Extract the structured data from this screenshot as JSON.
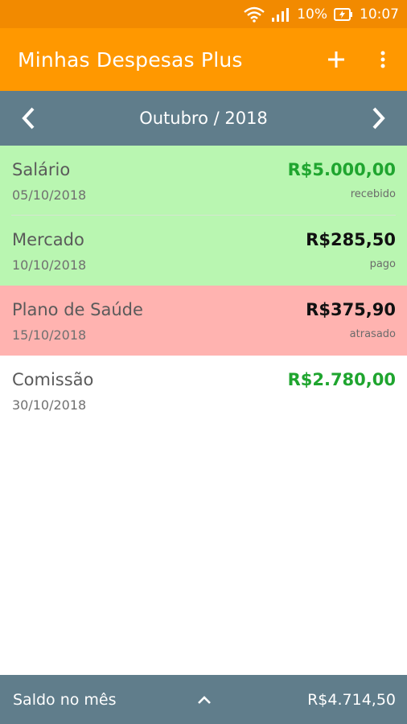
{
  "status_bar": {
    "battery_percent": "10%",
    "time": "10:07",
    "icons": [
      "wifi-icon",
      "signal-icon",
      "battery-charging-icon"
    ]
  },
  "app_bar": {
    "title": "Minhas Despesas Plus",
    "add_icon": "plus-icon",
    "more_icon": "more-vert-icon"
  },
  "month_bar": {
    "label": "Outubro / 2018",
    "prev_icon": "chevron-left-icon",
    "next_icon": "chevron-right-icon"
  },
  "colors": {
    "status_bar": "#f28a00",
    "app_bar": "#ff9800",
    "month_bar": "#607d8b",
    "received_bg": "#b9f6b1",
    "late_bg": "#ffb3b0",
    "income_text": "#1fa52f",
    "expense_text": "#111111"
  },
  "transactions": [
    {
      "title": "Salário",
      "date": "05/10/2018",
      "amount": "R$5.000,00",
      "status": "recebido",
      "kind": "income",
      "bg": "#b9f6b1"
    },
    {
      "title": "Mercado",
      "date": "10/10/2018",
      "amount": "R$285,50",
      "status": "pago",
      "kind": "expense",
      "bg": "#b9f6b1"
    },
    {
      "title": "Plano de Saúde",
      "date": "15/10/2018",
      "amount": "R$375,90",
      "status": "atrasado",
      "kind": "expense",
      "bg": "#ffb3b0"
    },
    {
      "title": "Comissão",
      "date": "30/10/2018",
      "amount": "R$2.780,00",
      "status": "",
      "kind": "income",
      "bg": "#ffffff"
    }
  ],
  "bottom_bar": {
    "label": "Saldo no mês",
    "balance": "R$4.714,50",
    "expand_icon": "chevron-up-icon"
  }
}
